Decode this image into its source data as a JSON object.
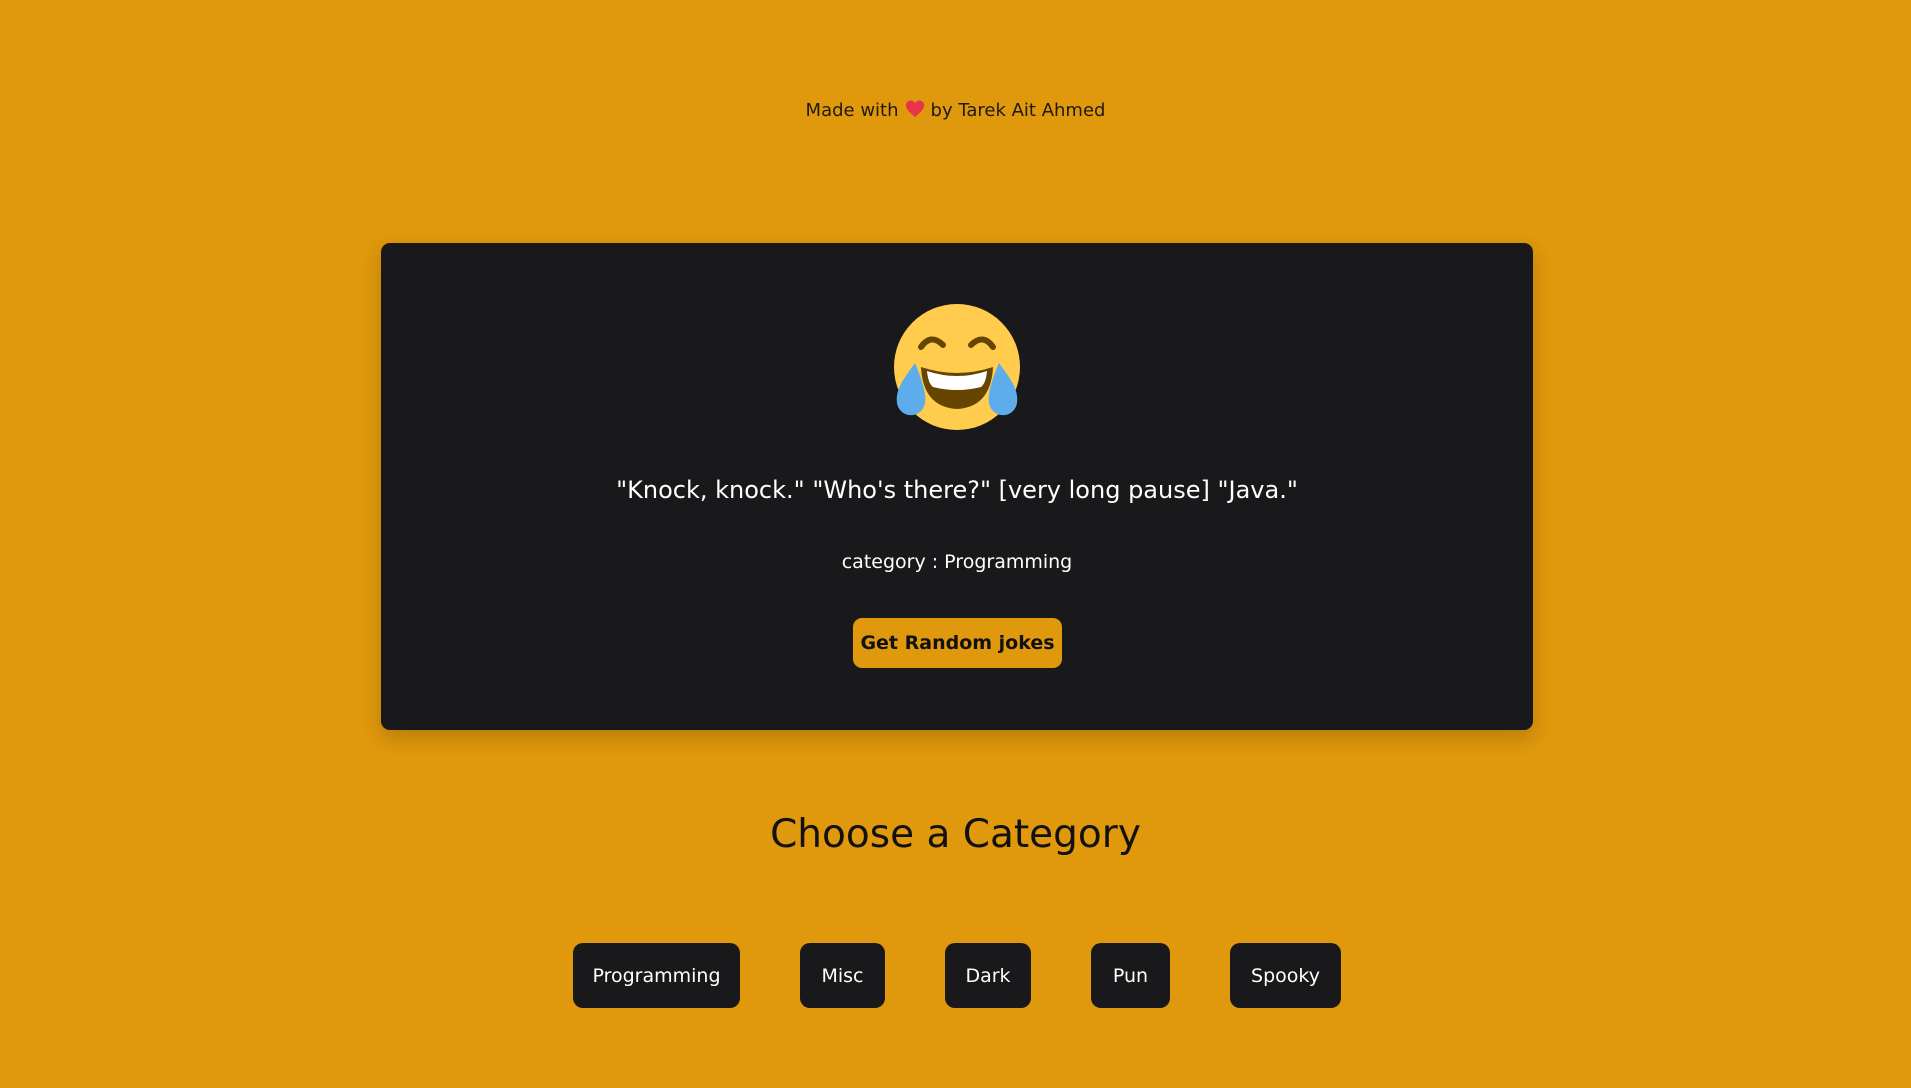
{
  "header": {
    "credit_prefix": "Made with",
    "credit_suffix": "by Tarek Ait Ahmed",
    "heart_icon": "heart-icon",
    "heart_color": "#e8334a"
  },
  "joke_card": {
    "emoji_icon": "face-with-tears-of-joy-icon",
    "joke_text": "\"Knock, knock.\" \"Who's there?\" [very long pause] \"Java.\"",
    "category_text": "category : Programming",
    "random_button_label": "Get Random jokes"
  },
  "categories": {
    "title": "Choose a Category",
    "buttons": [
      "Programming",
      "Misc",
      "Dark",
      "Pun",
      "Spooky"
    ]
  },
  "colors": {
    "background": "#e0980c",
    "card": "#19181a",
    "accent": "#e0980c"
  }
}
